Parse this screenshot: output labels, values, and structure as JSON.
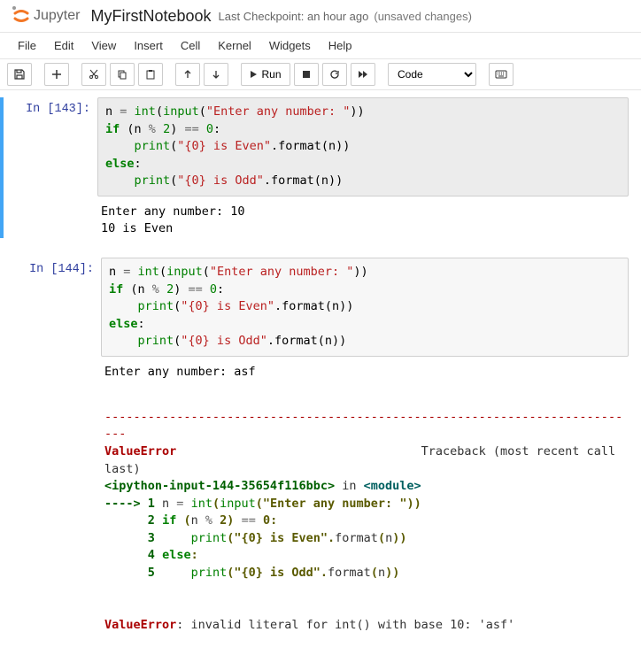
{
  "header": {
    "logo_text": "Jupyter",
    "notebook_name": "MyFirstNotebook",
    "checkpoint": "Last Checkpoint: an hour ago",
    "unsaved": "(unsaved changes)"
  },
  "menu": [
    "File",
    "Edit",
    "View",
    "Insert",
    "Cell",
    "Kernel",
    "Widgets",
    "Help"
  ],
  "toolbar": {
    "run_label": "Run",
    "cell_type": "Code"
  },
  "cells": [
    {
      "prompt": "In [143]:",
      "code_html": "n <span class='o'>=</span> <span class='nb'>int</span>(<span class='nb'>input</span>(<span class='s'>\"Enter any number: \"</span>))\n<span class='k'>if</span> (n <span class='o'>%</span> <span class='mi'>2</span>) <span class='o'>==</span> <span class='mi'>0</span>:\n    <span class='nb'>print</span>(<span class='s'>\"{0} is Even\"</span>.format(n))\n<span class='k'>else</span>:\n    <span class='nb'>print</span>(<span class='s'>\"{0} is Odd\"</span>.format(n))",
      "output": "Enter any number: 10\n10 is Even"
    },
    {
      "prompt": "In [144]:",
      "code_html": "n <span class='o'>=</span> <span class='nb'>int</span>(<span class='nb'>input</span>(<span class='s'>\"Enter any number: \"</span>))\n<span class='k'>if</span> (n <span class='o'>%</span> <span class='mi'>2</span>) <span class='o'>==</span> <span class='mi'>0</span>:\n    <span class='nb'>print</span>(<span class='s'>\"{0} is Even\"</span>.format(n))\n<span class='k'>else</span>:\n    <span class='nb'>print</span>(<span class='s'>\"{0} is Odd\"</span>.format(n))",
      "output": "Enter any number: asf",
      "traceback": {
        "sep": "---------------------------------------------------------------------------",
        "err_name": "ValueError",
        "tb_label": "Traceback (most recent call last)",
        "frame": "<ipython-input-144-35654f116bbc>",
        "in_label": " in ",
        "module": "<module>",
        "lines": [
          {
            "marker": "----> ",
            "ln": "1",
            "code": "n <span class='o'>=</span> <span class='nb'>int</span><span class='tb-s'>(</span><span class='nb'>input</span><span class='tb-s'>(</span><span class='tb-s'>\"Enter any number: \"</span><span class='tb-s'>))</span>"
          },
          {
            "marker": "      ",
            "ln": "2",
            "code": "<span class='k'>if</span> <span class='tb-s'>(</span>n <span class='o'>%</span> <span class='tb-s'>2)</span> <span class='o'>==</span> <span class='tb-s'>0:</span>"
          },
          {
            "marker": "      ",
            "ln": "3",
            "code": "    <span class='nb'>print</span><span class='tb-s'>(</span><span class='tb-s'>\"{0} is Even\"</span><span class='tb-s'>.</span>format<span class='tb-s'>(</span>n<span class='tb-s'>))</span>"
          },
          {
            "marker": "      ",
            "ln": "4",
            "code": "<span class='k'>else</span><span class='tb-s'>:</span>"
          },
          {
            "marker": "      ",
            "ln": "5",
            "code": "    <span class='nb'>print</span><span class='tb-s'>(</span><span class='tb-s'>\"{0} is Odd\"</span><span class='tb-s'>.</span>format<span class='tb-s'>(</span>n<span class='tb-s'>))</span>"
          }
        ],
        "final": "ValueError",
        "final_msg": ": invalid literal for int() with base 10: 'asf'"
      }
    }
  ]
}
